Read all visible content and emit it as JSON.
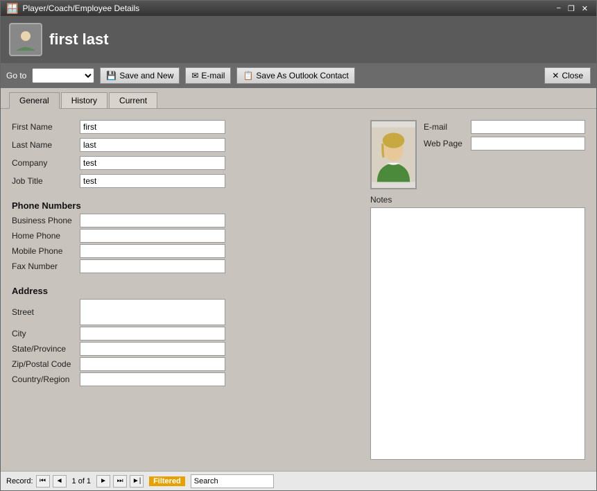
{
  "window": {
    "title": "Player/Coach/Employee Details",
    "controls": {
      "minimize": "−",
      "restore": "❒",
      "close": "✕"
    }
  },
  "header": {
    "title": "first last"
  },
  "toolbar": {
    "goto_label": "Go to",
    "goto_placeholder": "",
    "save_and_new": "Save and New",
    "email": "E-mail",
    "save_as_outlook": "Save As Outlook Contact",
    "close": "Close"
  },
  "tabs": [
    {
      "label": "General",
      "active": true
    },
    {
      "label": "History",
      "active": false
    },
    {
      "label": "Current",
      "active": false
    }
  ],
  "form": {
    "first_name_label": "First Name",
    "first_name_value": "first",
    "last_name_label": "Last Name",
    "last_name_value": "last",
    "company_label": "Company",
    "company_value": "test",
    "job_title_label": "Job Title",
    "job_title_value": "test",
    "phone_section": "Phone Numbers",
    "business_phone_label": "Business Phone",
    "business_phone_value": "",
    "home_phone_label": "Home Phone",
    "home_phone_value": "",
    "mobile_phone_label": "Mobile Phone",
    "mobile_phone_value": "",
    "fax_number_label": "Fax Number",
    "fax_number_value": "",
    "address_section": "Address",
    "street_label": "Street",
    "street_value": "",
    "city_label": "City",
    "city_value": "",
    "state_label": "State/Province",
    "state_value": "",
    "zip_label": "Zip/Postal Code",
    "zip_value": "",
    "country_label": "Country/Region",
    "country_value": "",
    "email_label": "E-mail",
    "email_value": "",
    "webpage_label": "Web Page",
    "webpage_value": "",
    "notes_label": "Notes",
    "notes_value": ""
  },
  "status_bar": {
    "record_label": "Record:",
    "first_nav": "⏮",
    "prev_nav": "◄",
    "record_info": "1 of 1",
    "next_nav": "►",
    "last_nav": "⏭",
    "new_nav": "►|",
    "filtered_label": "Filtered",
    "search_placeholder": "Search",
    "search_value": "Search"
  }
}
